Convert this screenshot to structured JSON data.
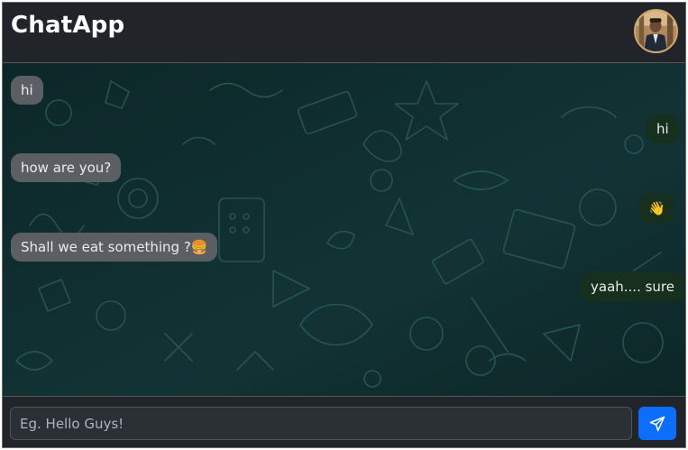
{
  "header": {
    "title": "ChatApp",
    "avatar_icon": "user-avatar"
  },
  "messages": [
    {
      "side": "in",
      "text": "hi"
    },
    {
      "side": "out",
      "text": "hi"
    },
    {
      "side": "in",
      "text": "how are you?"
    },
    {
      "side": "out",
      "text": "👋"
    },
    {
      "side": "in",
      "text": "Shall we eat something ?🍔"
    },
    {
      "side": "out",
      "text": "yaah.... sure"
    }
  ],
  "composer": {
    "placeholder": "Eg. Hello Guys!",
    "value": "",
    "send_icon": "send-icon"
  },
  "colors": {
    "accent": "#0d6efd",
    "incoming": "#5b5e62",
    "outgoing": "#17301e",
    "chat_bg": "#0f2b2c"
  }
}
